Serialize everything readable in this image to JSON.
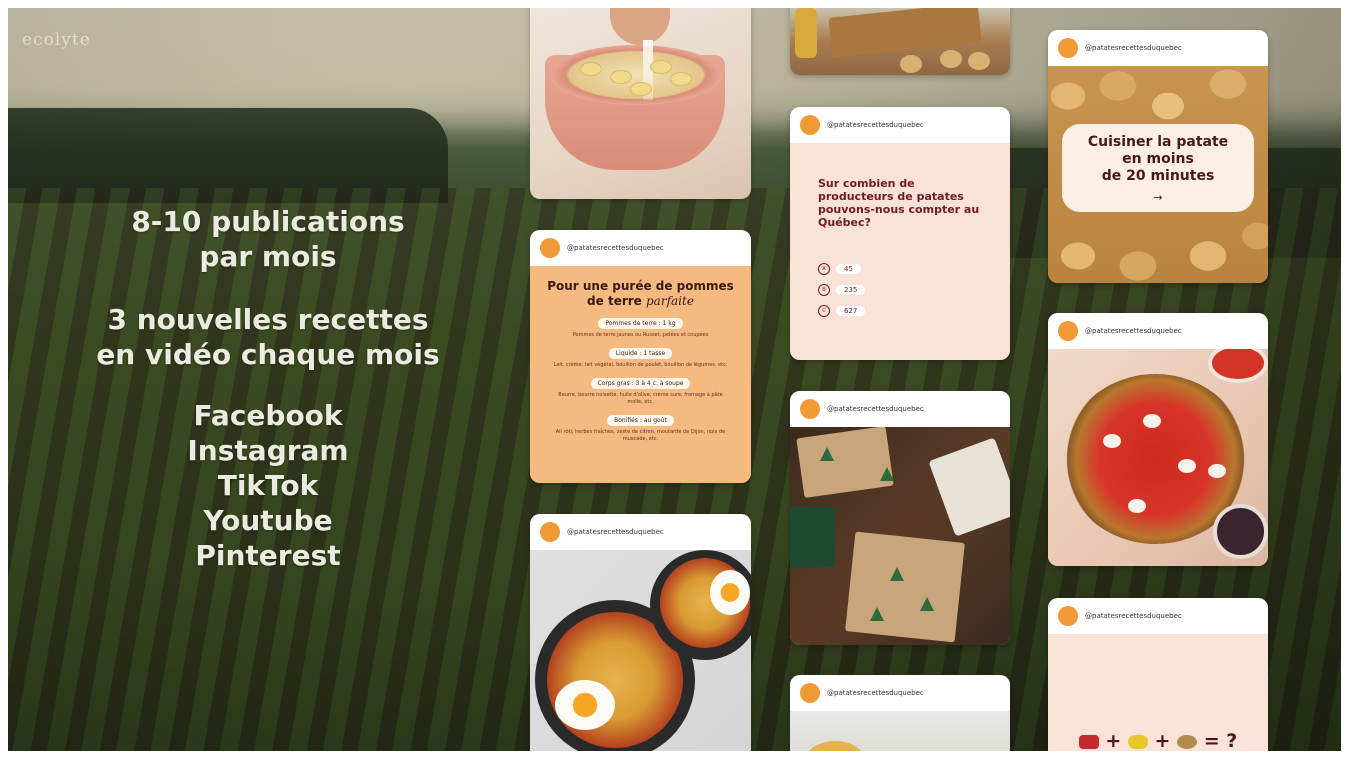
{
  "brand": "ecolyte",
  "headline": {
    "line1": "8-10 publications",
    "line2": "par mois",
    "line3": "3 nouvelles recettes",
    "line4": "en vidéo chaque mois"
  },
  "platforms": [
    "Facebook",
    "Instagram",
    "TikTok",
    "Youtube",
    "Pinterest"
  ],
  "account_handle": "@patatesrecettesduquebec",
  "recipe_card": {
    "title_line1": "Pour une purée de pommes",
    "title_line2": "de terre",
    "title_script": "parfaite",
    "items": [
      {
        "pill": "Pommes de terre : 1 kg",
        "note": "Pommes de terre jaunes ou Russet, pelées et coupées"
      },
      {
        "pill": "Liquide : 1 tasse",
        "note": "Lait, crème, lait végétal, bouillon de poulet, bouillon de légumes, etc."
      },
      {
        "pill": "Corps gras : 3 à 4 c. à soupe",
        "note": "Beurre, beurre noisette, huile d'olive, crème sure, fromage à pâte molle, etc."
      },
      {
        "pill": "Bonifiés : au goût",
        "note": "Ail rôti, herbes fraîches, zeste de citron, moutarde de Dijon, noix de muscade, etc."
      }
    ]
  },
  "quiz_card": {
    "question": "Sur combien de producteurs de patates pouvons-nous compter au Québec?",
    "options": [
      {
        "letter": "A",
        "value": "45"
      },
      {
        "letter": "B",
        "value": "235"
      },
      {
        "letter": "C",
        "value": "627"
      }
    ]
  },
  "potato_card": {
    "line1": "Cuisiner la patate",
    "line2": "en moins",
    "line3": "de 20 minutes",
    "arrow": "→"
  },
  "emoji_card": {
    "plus1": "+",
    "plus2": "+",
    "equals": "=",
    "question": "?"
  }
}
